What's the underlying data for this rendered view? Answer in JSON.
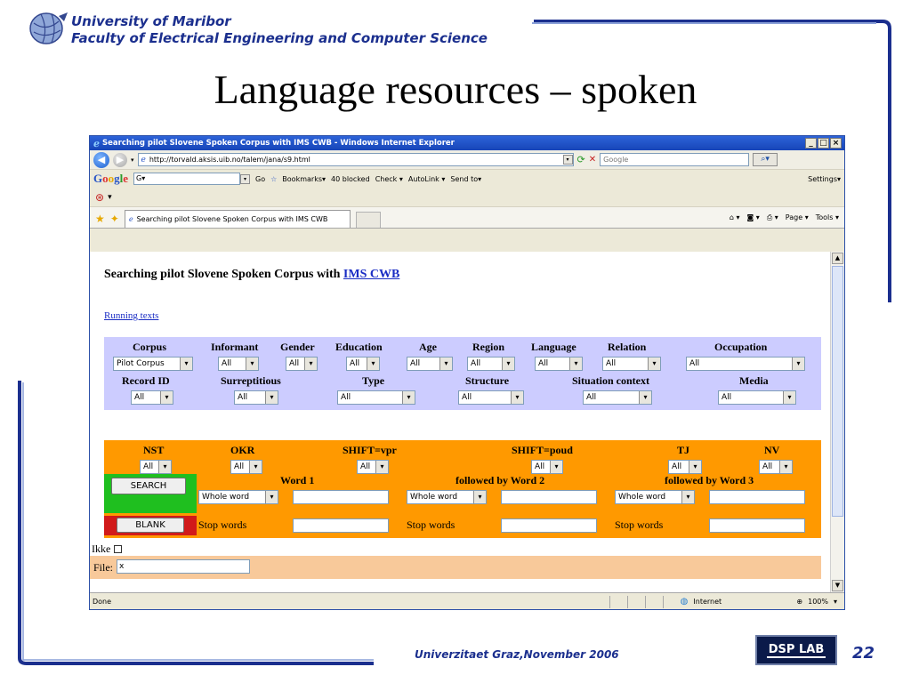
{
  "slide": {
    "university": "University of Maribor",
    "faculty": "Faculty of Electrical Engineering and Computer Science",
    "title": "Language resources – spoken",
    "footer": "Univerzitaet Graz,November 2006",
    "page_number": "22",
    "lab_logo_text": "DSP LAB"
  },
  "browser": {
    "window_title": "Searching pilot Slovene Spoken Corpus with IMS CWB - Windows Internet Explorer",
    "address": "http://torvald.aksis.uib.no/talem/jana/s9.html",
    "search_placeholder": "Google",
    "google_bar": {
      "go_label": "Go",
      "bookmarks_label": "Bookmarks▾",
      "blocked_label": "40 blocked",
      "check_label": "Check ▾",
      "autolink_label": "AutoLink ▾",
      "sendto_label": "Send to▾",
      "settings_label": "Settings▾"
    },
    "tab_label": "Searching pilot Slovene Spoken Corpus with IMS CWB",
    "page_menu": "Page ▾",
    "tools_menu": "Tools ▾",
    "status_text": "Done",
    "zone_text": "Internet",
    "zoom_text": "100%"
  },
  "page": {
    "heading_prefix": "Searching pilot Slovene Spoken Corpus with",
    "heading_link": "IMS CWB",
    "running_texts": "Running texts",
    "filters_row1": {
      "corpus": {
        "label": "Corpus",
        "value": "Pilot Corpus"
      },
      "informant": {
        "label": "Informant",
        "value": "All"
      },
      "gender": {
        "label": "Gender",
        "value": "All"
      },
      "education": {
        "label": "Education",
        "value": "All"
      },
      "age": {
        "label": "Age",
        "value": "All"
      },
      "region": {
        "label": "Region",
        "value": "All"
      },
      "language": {
        "label": "Language",
        "value": "All"
      },
      "relation": {
        "label": "Relation",
        "value": "All"
      },
      "occupation": {
        "label": "Occupation",
        "value": "All"
      }
    },
    "filters_row2": {
      "record_id": {
        "label": "Record ID",
        "value": "All"
      },
      "surreptitious": {
        "label": "Surreptitious",
        "value": "All"
      },
      "type": {
        "label": "Type",
        "value": "All"
      },
      "structure": {
        "label": "Structure",
        "value": "All"
      },
      "situation": {
        "label": "Situation context",
        "value": "All"
      },
      "media": {
        "label": "Media",
        "value": "All"
      }
    },
    "attrs": {
      "nst": {
        "label": "NST",
        "value": "All"
      },
      "okr": {
        "label": "OKR",
        "value": "All"
      },
      "shift_vpr": {
        "label": "SHIFT=vpr",
        "value": "All"
      },
      "shift_poud": {
        "label": "SHIFT=poud",
        "value": "All"
      },
      "tj": {
        "label": "TJ",
        "value": "All"
      },
      "nv": {
        "label": "NV",
        "value": "All"
      }
    },
    "word1_label": "Word 1",
    "word2_label": "followed by Word 2",
    "word3_label": "followed by Word 3",
    "match_mode": "Whole word",
    "stop_words": "Stop words",
    "search_button": "SEARCH",
    "blank_button": "BLANK",
    "ikke_label": "Ikke",
    "file_label": "File:",
    "file_value": "x"
  }
}
